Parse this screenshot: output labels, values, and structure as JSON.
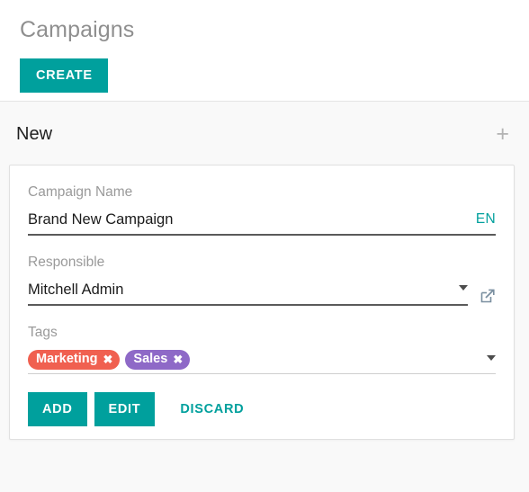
{
  "control_panel": {
    "breadcrumb_title": "Campaigns",
    "create_label": "CREATE"
  },
  "kanban": {
    "column": {
      "title": "New",
      "add_icon": "+"
    }
  },
  "quick_create": {
    "fields": {
      "campaign_name": {
        "label": "Campaign Name",
        "value": "Brand New Campaign",
        "placeholder": "Campaign Name",
        "lang_badge": "EN"
      },
      "responsible": {
        "label": "Responsible",
        "value": "Mitchell Admin",
        "placeholder": "Responsible",
        "external_link_icon": "external-link-icon"
      },
      "tags": {
        "label": "Tags",
        "items": [
          {
            "name": "Marketing",
            "color": "#f06050",
            "remove_icon": "✖"
          },
          {
            "name": "Sales",
            "color": "#8e69c7",
            "remove_icon": "✖"
          }
        ]
      }
    },
    "footer": {
      "add_label": "ADD",
      "edit_label": "EDIT",
      "discard_label": "DISCARD"
    }
  },
  "theme": {
    "accent": "#00a09d",
    "label_gray": "#9a9a9a",
    "title_gray": "#8f8f8f",
    "panel_bg": "#f9f9f9"
  }
}
